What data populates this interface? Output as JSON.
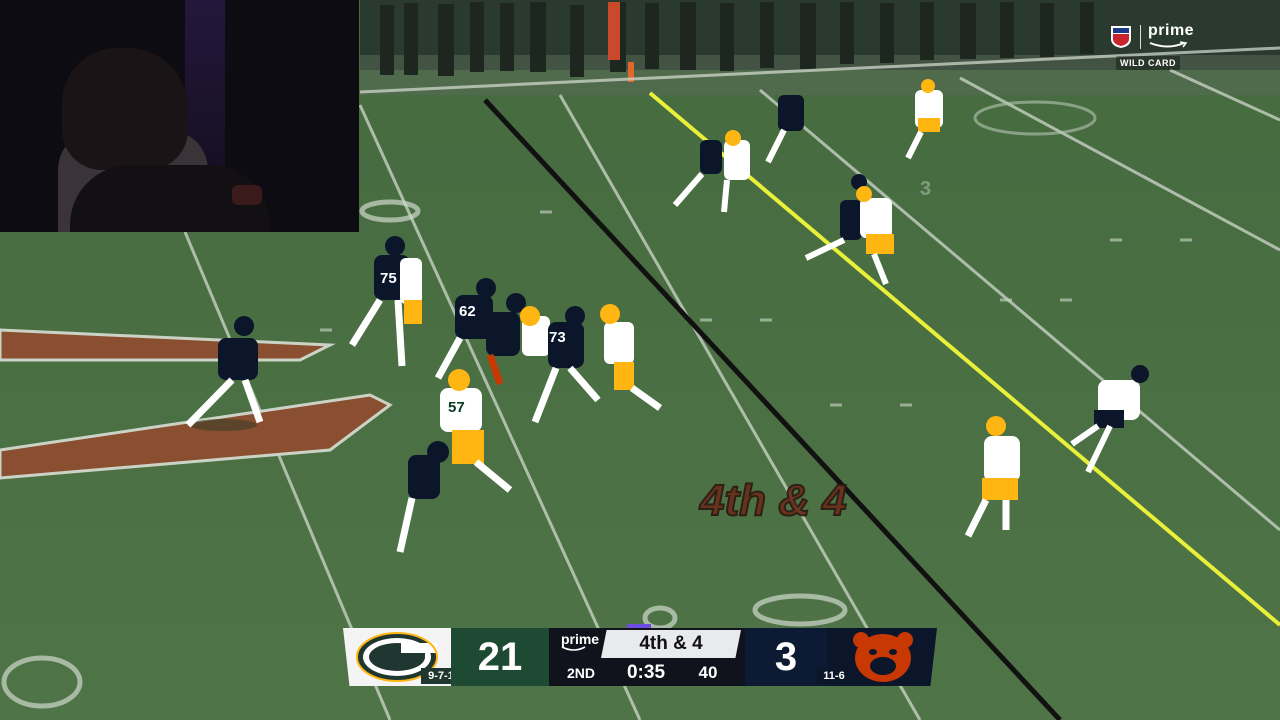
{
  "broadcast": {
    "network": "prime",
    "round_label": "WILD CARD",
    "field_text": "4th & 4"
  },
  "scorebug": {
    "away": {
      "score": "21",
      "record": "9-7-1",
      "logo": "packers-g-logo-icon",
      "color": "#203731"
    },
    "home": {
      "score": "3",
      "record": "11-6",
      "logo": "bears-head-logo-icon",
      "color": "#0b162a"
    },
    "network": "prime",
    "down_distance": "4th & 4",
    "quarter": "2ND",
    "game_clock": "0:35",
    "play_clock": "40"
  },
  "field_numbers": {
    "left_far": "0",
    "top_center": "3",
    "bottom_right": "0",
    "bottom_left": "0"
  },
  "players": [
    {
      "team": "home",
      "number": "75"
    },
    {
      "team": "home",
      "number": "62"
    },
    {
      "team": "home",
      "number": "73"
    },
    {
      "team": "away",
      "number": "57"
    }
  ],
  "colors": {
    "turf": "#4b6e44",
    "first_down_line": "#e8f03a",
    "line_of_scrimmage": "#111111",
    "bears_navy": "#0b162a",
    "bears_orange": "#c83803",
    "packers_green": "#203731",
    "packers_gold": "#ffb612"
  }
}
